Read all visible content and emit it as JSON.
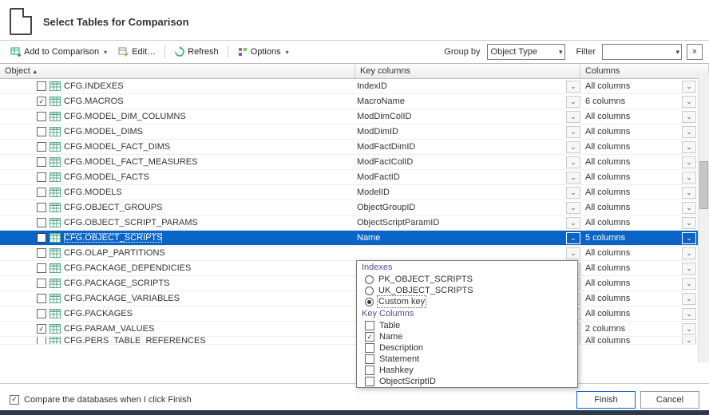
{
  "header": {
    "title": "Select Tables for Comparison"
  },
  "toolbar": {
    "add": "Add to Comparison",
    "edit": "Edit…",
    "refresh": "Refresh",
    "options": "Options",
    "groupby_label": "Group by",
    "groupby_value": "Object Type",
    "filter_label": "Filter",
    "filter_value": "",
    "clear_filter": "×"
  },
  "columns": {
    "object": "Object",
    "key": "Key columns",
    "cols": "Columns"
  },
  "rows": [
    {
      "checked": false,
      "name": "CFG.INDEXES",
      "key": "IndexID",
      "cols": "All columns"
    },
    {
      "checked": true,
      "name": "CFG.MACROS",
      "key": "MacroName",
      "cols": "6 columns"
    },
    {
      "checked": false,
      "name": "CFG.MODEL_DIM_COLUMNS",
      "key": "ModDimColID",
      "cols": "All columns"
    },
    {
      "checked": false,
      "name": "CFG.MODEL_DIMS",
      "key": "ModDimID",
      "cols": "All columns"
    },
    {
      "checked": false,
      "name": "CFG.MODEL_FACT_DIMS",
      "key": "ModFactDimID",
      "cols": "All columns"
    },
    {
      "checked": false,
      "name": "CFG.MODEL_FACT_MEASURES",
      "key": "ModFactColID",
      "cols": "All columns"
    },
    {
      "checked": false,
      "name": "CFG.MODEL_FACTS",
      "key": "ModFactID",
      "cols": "All columns"
    },
    {
      "checked": false,
      "name": "CFG.MODELS",
      "key": "ModelID",
      "cols": "All columns"
    },
    {
      "checked": false,
      "name": "CFG.OBJECT_GROUPS",
      "key": "ObjectGroupID",
      "cols": "All columns"
    },
    {
      "checked": false,
      "name": "CFG.OBJECT_SCRIPT_PARAMS",
      "key": "ObjectScriptParamID",
      "cols": "All columns"
    },
    {
      "checked": true,
      "name": "CFG.OBJECT_SCRIPTS",
      "key": "Name",
      "cols": "5 columns",
      "selected": true
    },
    {
      "checked": false,
      "name": "CFG.OLAP_PARTITIONS",
      "key": "",
      "cols": "All columns"
    },
    {
      "checked": false,
      "name": "CFG.PACKAGE_DEPENDICIES",
      "key": "",
      "cols": "All columns"
    },
    {
      "checked": false,
      "name": "CFG.PACKAGE_SCRIPTS",
      "key": "",
      "cols": "All columns"
    },
    {
      "checked": false,
      "name": "CFG.PACKAGE_VARIABLES",
      "key": "",
      "cols": "All columns"
    },
    {
      "checked": false,
      "name": "CFG.PACKAGES",
      "key": "",
      "cols": "All columns"
    },
    {
      "checked": true,
      "name": "CFG.PARAM_VALUES",
      "key": "",
      "cols": "2 columns"
    },
    {
      "checked": false,
      "name": "CFG.PERS_TABLE_REFERENCES",
      "key": "",
      "cols": "All columns",
      "partial": true
    }
  ],
  "popup": {
    "indexes_title": "Indexes",
    "index_options": [
      {
        "label": "PK_OBJECT_SCRIPTS",
        "checked": false
      },
      {
        "label": "UK_OBJECT_SCRIPTS",
        "checked": false
      },
      {
        "label": "Custom key",
        "checked": true
      }
    ],
    "keycols_title": "Key Columns",
    "key_columns": [
      {
        "label": "Table",
        "checked": false
      },
      {
        "label": "Name",
        "checked": true
      },
      {
        "label": "Description",
        "checked": false
      },
      {
        "label": "Statement",
        "checked": false
      },
      {
        "label": "Hashkey",
        "checked": false
      },
      {
        "label": "ObjectScriptID",
        "checked": false
      }
    ]
  },
  "footer": {
    "compare_label": "Compare the databases when I click Finish",
    "compare_checked": true,
    "finish": "Finish",
    "cancel": "Cancel"
  }
}
